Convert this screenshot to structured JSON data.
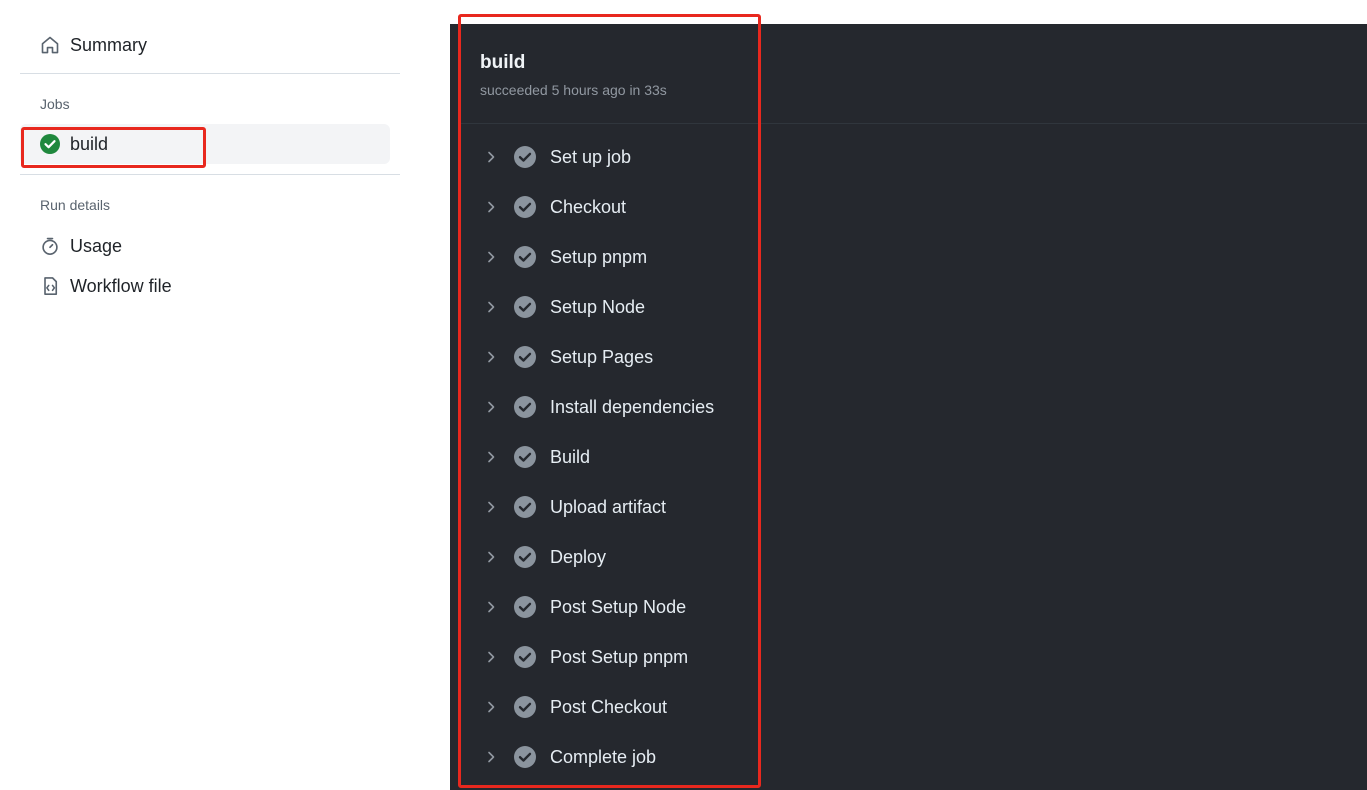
{
  "sidebar": {
    "summary_label": "Summary",
    "jobs_heading": "Jobs",
    "job": {
      "name": "build",
      "status": "success"
    },
    "run_details_heading": "Run details",
    "usage_label": "Usage",
    "workflow_file_label": "Workflow file"
  },
  "panel": {
    "title": "build",
    "subtitle": "succeeded 5 hours ago in 33s",
    "steps": [
      "Set up job",
      "Checkout",
      "Setup pnpm",
      "Setup Node",
      "Setup Pages",
      "Install dependencies",
      "Build",
      "Upload artifact",
      "Deploy",
      "Post Setup Node",
      "Post Setup pnpm",
      "Post Checkout",
      "Complete job"
    ]
  },
  "colors": {
    "success": "#1f883d",
    "panel_bg": "#25282e",
    "highlight": "#e8281e",
    "step_check": "#8b949e"
  }
}
